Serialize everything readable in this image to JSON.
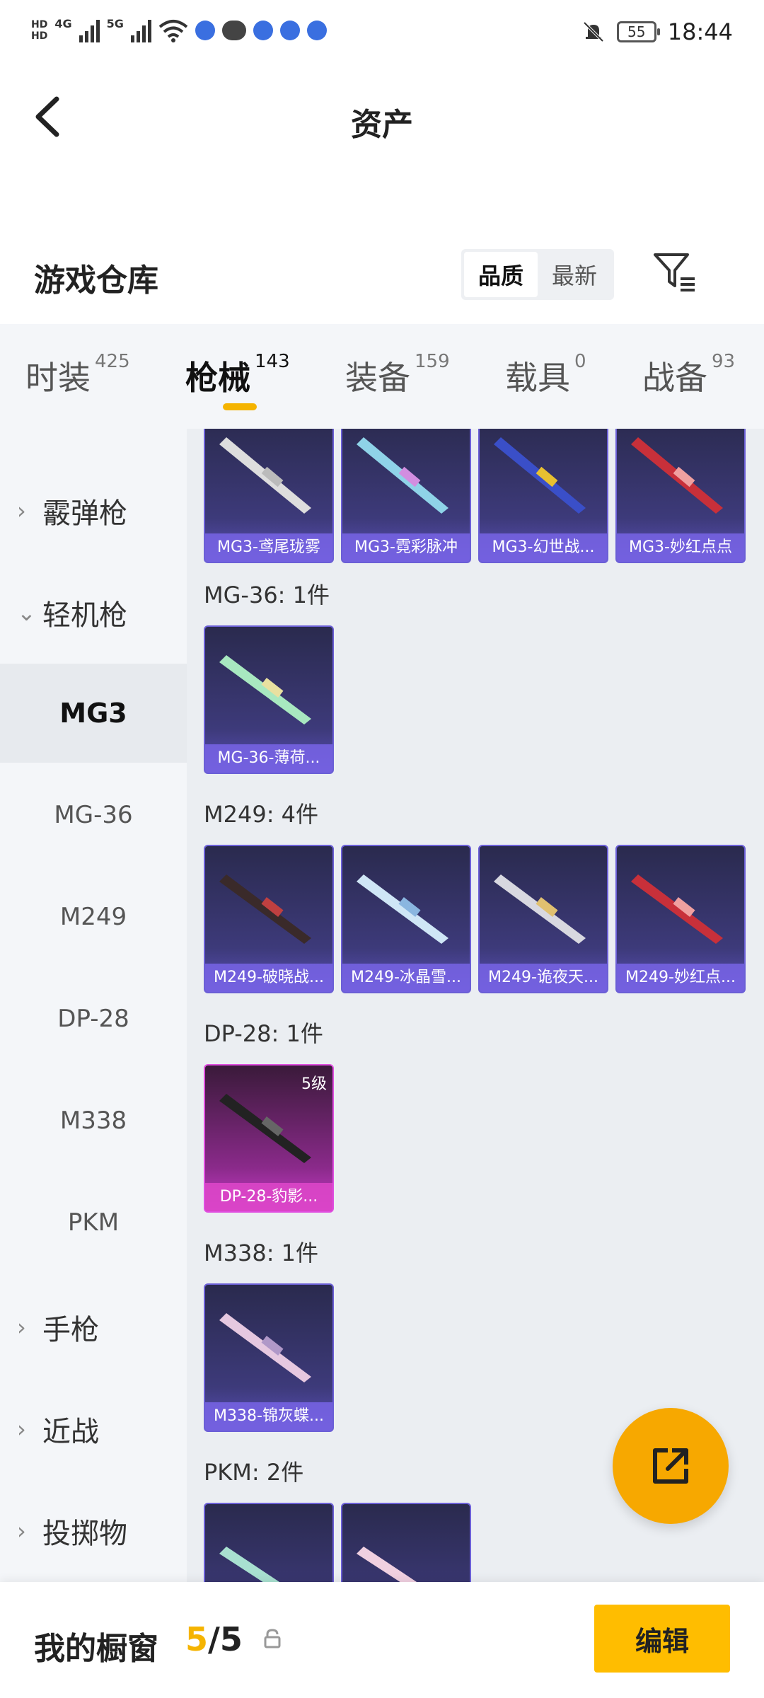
{
  "status_bar": {
    "network_1": "4G",
    "network_2": "5G",
    "battery": "55",
    "time": "18:44"
  },
  "header": {
    "title": "资产"
  },
  "warehouse": {
    "title": "游戏仓库",
    "sort_options": [
      "品质",
      "最新"
    ],
    "sort_active": "品质"
  },
  "tabs": [
    {
      "label": "时装",
      "count": "425"
    },
    {
      "label": "枪械",
      "count": "143"
    },
    {
      "label": "装备",
      "count": "159"
    },
    {
      "label": "载具",
      "count": "0"
    },
    {
      "label": "战备",
      "count": "93"
    }
  ],
  "sidebar": {
    "categories": [
      {
        "label": "霰弹枪",
        "expanded": false
      },
      {
        "label": "轻机枪",
        "expanded": true
      },
      {
        "label": "手枪",
        "expanded": false
      },
      {
        "label": "近战",
        "expanded": false
      },
      {
        "label": "投掷物",
        "expanded": false
      }
    ],
    "subitems": [
      "MG3",
      "MG-36",
      "M249",
      "DP-28",
      "M338",
      "PKM"
    ],
    "active_subitem": "MG3"
  },
  "content": {
    "mg3_items": [
      "MG3-鸢尾珑雾",
      "MG3-霓彩脉冲",
      "MG3-幻世战...",
      "MG3-妙红点点"
    ],
    "group_mg36": "MG-36: 1件",
    "mg36_items": [
      "MG-36-薄荷..."
    ],
    "group_m249": "M249: 4件",
    "m249_items": [
      "M249-破晓战...",
      "M249-冰晶雪...",
      "M249-诡夜天...",
      "M249-妙红点..."
    ],
    "group_dp28": "DP-28: 1件",
    "dp28_items": [
      "DP-28-豹影..."
    ],
    "dp28_level": "5级",
    "group_m338": "M338: 1件",
    "m338_items": [
      "M338-锦灰蝶..."
    ],
    "group_pkm": "PKM: 2件"
  },
  "bottom_bar": {
    "title": "我的橱窗",
    "count_current": "5",
    "count_total": "/5",
    "edit_label": "编辑"
  },
  "colors": {
    "accent": "#f5b400",
    "fab": "#f7a800",
    "card_blue": "#5a4fb8",
    "card_pink": "#c93bc9"
  }
}
